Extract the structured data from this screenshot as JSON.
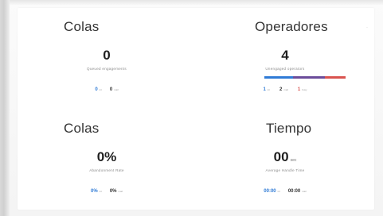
{
  "colors": {
    "accent_blue": "#2f7bd6",
    "dark": "#333333",
    "bar_blue": "#2f7bd6",
    "bar_purple": "#6b4c9a",
    "bar_red": "#d9534f"
  },
  "tiles": [
    {
      "title": "Colas",
      "value": "0",
      "unit": "",
      "caption": "Queued engagements",
      "stats": [
        {
          "value": "0",
          "label": "int",
          "color": "#2f7bd6"
        },
        {
          "value": "0",
          "label": "mail",
          "color": "#333333"
        }
      ]
    },
    {
      "title": "Operadores",
      "value": "4",
      "unit": "",
      "caption": "Unengaged operators",
      "corner_mark": "·",
      "bar": [
        {
          "share": 0.35,
          "color": "#2f7bd6"
        },
        {
          "share": 0.4,
          "color": "#6b4c9a"
        },
        {
          "share": 0.25,
          "color": "#d9534f"
        }
      ],
      "stats": [
        {
          "value": "1",
          "label": "int",
          "color": "#2f7bd6"
        },
        {
          "value": "2",
          "label": "mail",
          "color": "#333333"
        },
        {
          "value": "1",
          "label": "busy",
          "color": "#d9534f"
        }
      ]
    },
    {
      "title": "Colas",
      "value": "0%",
      "unit": "",
      "caption": "Abandonment Rate",
      "stats": [
        {
          "value": "0%",
          "label": "int",
          "color": "#2f7bd6"
        },
        {
          "value": "0%",
          "label": "mail",
          "color": "#333333"
        }
      ]
    },
    {
      "title": "Tiempo",
      "value": "00",
      "unit": "sec",
      "caption": "Average Handle Time",
      "stats": [
        {
          "value": "00:00",
          "label": "int",
          "color": "#2f7bd6"
        },
        {
          "value": "00:00",
          "label": "mail",
          "color": "#333333"
        }
      ]
    }
  ]
}
